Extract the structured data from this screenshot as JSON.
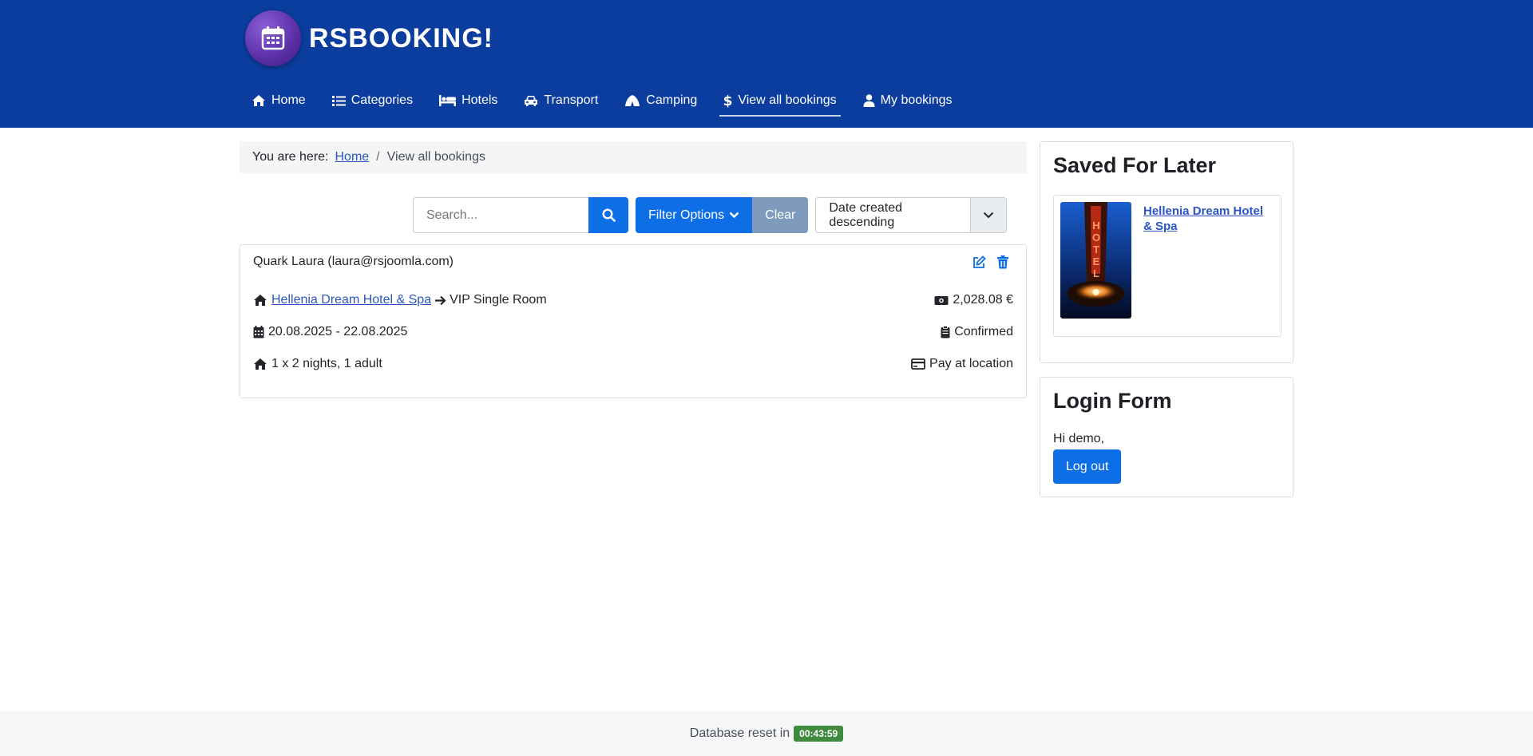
{
  "brand": {
    "title": "RSBOOKING!"
  },
  "nav": {
    "items": [
      {
        "label": "Home",
        "icon": "home-icon"
      },
      {
        "label": "Categories",
        "icon": "list-icon"
      },
      {
        "label": "Hotels",
        "icon": "bed-icon"
      },
      {
        "label": "Transport",
        "icon": "car-icon"
      },
      {
        "label": "Camping",
        "icon": "tent-icon"
      },
      {
        "label": "View all bookings",
        "icon": "dollar-icon",
        "active": true
      },
      {
        "label": "My bookings",
        "icon": "user-icon"
      }
    ]
  },
  "breadcrumb": {
    "prefix": "You are here:",
    "home": "Home",
    "separator": "/",
    "current": "View all bookings"
  },
  "toolbar": {
    "search_placeholder": "Search...",
    "filter_label": "Filter Options",
    "clear_label": "Clear",
    "sort_value": "Date created descending"
  },
  "booking": {
    "customer": "Quark Laura (laura@rsjoomla.com)",
    "hotel": "Hellenia Dream Hotel & Spa",
    "room": "VIP Single Room",
    "price": "2,028.08 €",
    "dates": "20.08.2025 - 22.08.2025",
    "status": "Confirmed",
    "stay": "1 x 2 nights, 1 adult",
    "payment": "Pay at location"
  },
  "saved_for_later": {
    "title": "Saved For Later",
    "item_name": "Hellenia Dream Hotel & Spa",
    "thumb_text": "HOTEL"
  },
  "login_form": {
    "title": "Login Form",
    "greeting": "Hi demo,",
    "logout_label": "Log out"
  },
  "footer": {
    "text": "Database reset in",
    "timer": "00:43:59"
  },
  "colors": {
    "header_bg": "#0b3d9e",
    "primary": "#0d6ee6",
    "clear_btn": "#7e9bbd",
    "link": "#2a55c2",
    "timer_badge": "#3f8a3f"
  }
}
